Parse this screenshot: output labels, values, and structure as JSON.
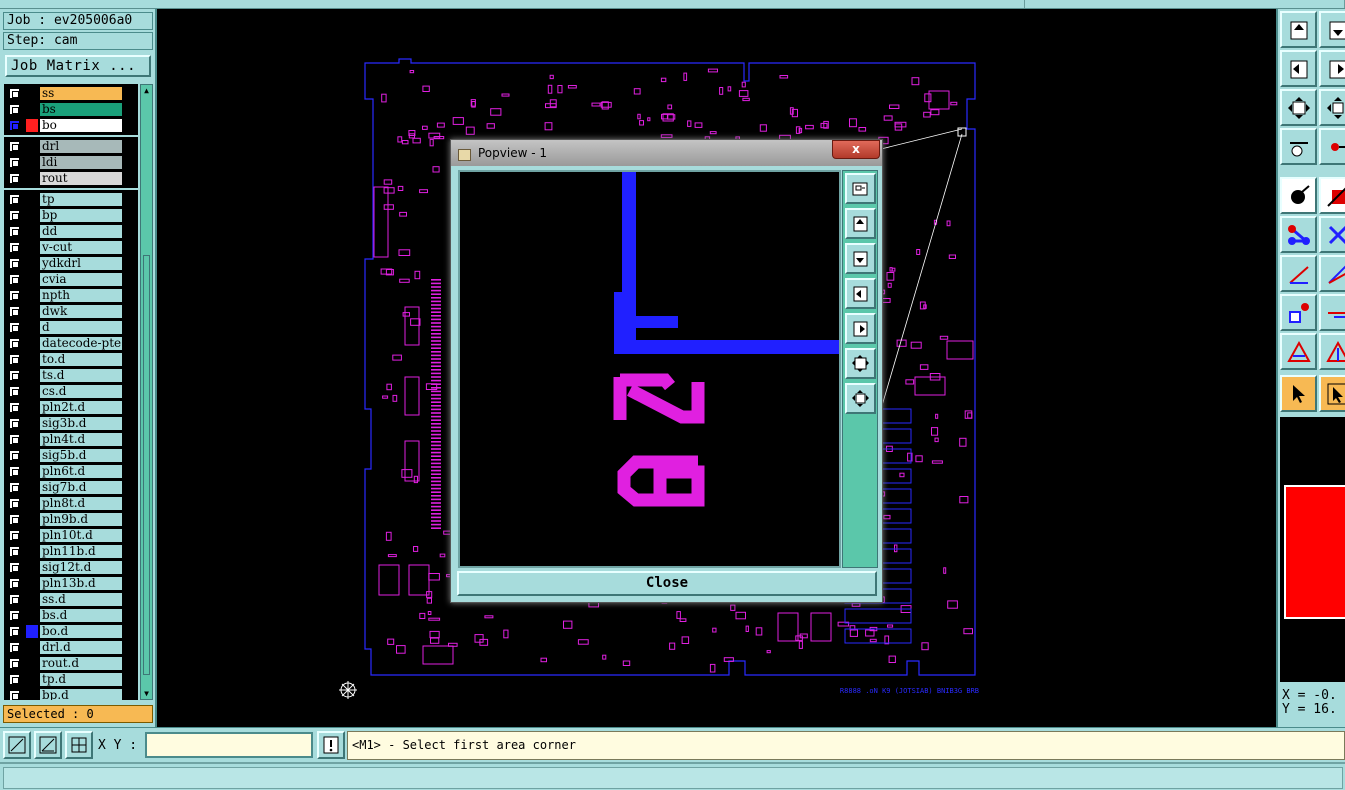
{
  "job": {
    "job_label": "Job : ev205006a0",
    "step_label": "Step: cam",
    "matrix_button": "Job Matrix ..."
  },
  "layers": [
    {
      "name": "ss",
      "color": "#f7b953",
      "swatch": "#000"
    },
    {
      "name": "bs",
      "color": "#1aa07a",
      "swatch": "#000"
    },
    {
      "name": "bo",
      "color": "#ffffff",
      "swatch": "#ff2020",
      "active": true
    },
    {
      "name": "drl",
      "color": "#a7b9b9",
      "swatch": "#000"
    },
    {
      "name": "ldi",
      "color": "#a7b9b9",
      "swatch": "#000"
    },
    {
      "name": "rout",
      "color": "#d8d8d8",
      "swatch": "#000"
    },
    {
      "name": "tp",
      "color": "#a7dcdc",
      "swatch": "#000"
    },
    {
      "name": "bp",
      "color": "#a7dcdc",
      "swatch": "#000"
    },
    {
      "name": "dd",
      "color": "#a7dcdc",
      "swatch": "#000"
    },
    {
      "name": "v-cut",
      "color": "#a7dcdc",
      "swatch": "#000"
    },
    {
      "name": "ydkdrl",
      "color": "#a7dcdc",
      "swatch": "#000"
    },
    {
      "name": "cvia",
      "color": "#a7dcdc",
      "swatch": "#000"
    },
    {
      "name": "npth",
      "color": "#a7dcdc",
      "swatch": "#000"
    },
    {
      "name": "dwk",
      "color": "#a7dcdc",
      "swatch": "#000"
    },
    {
      "name": "d",
      "color": "#a7dcdc",
      "swatch": "#000"
    },
    {
      "name": "datecode-pte",
      "color": "#a7dcdc",
      "swatch": "#000"
    },
    {
      "name": "to.d",
      "color": "#a7dcdc",
      "swatch": "#000"
    },
    {
      "name": "ts.d",
      "color": "#a7dcdc",
      "swatch": "#000"
    },
    {
      "name": "cs.d",
      "color": "#a7dcdc",
      "swatch": "#000"
    },
    {
      "name": "pln2t.d",
      "color": "#a7dcdc",
      "swatch": "#000"
    },
    {
      "name": "sig3b.d",
      "color": "#a7dcdc",
      "swatch": "#000"
    },
    {
      "name": "pln4t.d",
      "color": "#a7dcdc",
      "swatch": "#000"
    },
    {
      "name": "sig5b.d",
      "color": "#a7dcdc",
      "swatch": "#000"
    },
    {
      "name": "pln6t.d",
      "color": "#a7dcdc",
      "swatch": "#000"
    },
    {
      "name": "sig7b.d",
      "color": "#a7dcdc",
      "swatch": "#000"
    },
    {
      "name": "pln8t.d",
      "color": "#a7dcdc",
      "swatch": "#000"
    },
    {
      "name": "pln9b.d",
      "color": "#a7dcdc",
      "swatch": "#000"
    },
    {
      "name": "pln10t.d",
      "color": "#a7dcdc",
      "swatch": "#000"
    },
    {
      "name": "pln11b.d",
      "color": "#a7dcdc",
      "swatch": "#000"
    },
    {
      "name": "sig12t.d",
      "color": "#a7dcdc",
      "swatch": "#000"
    },
    {
      "name": "pln13b.d",
      "color": "#a7dcdc",
      "swatch": "#000"
    },
    {
      "name": "ss.d",
      "color": "#a7dcdc",
      "swatch": "#000"
    },
    {
      "name": "bs.d",
      "color": "#a7dcdc",
      "swatch": "#000"
    },
    {
      "name": "bo.d",
      "color": "#a7dcdc",
      "swatch": "#2020ff"
    },
    {
      "name": "drl.d",
      "color": "#a7dcdc",
      "swatch": "#000"
    },
    {
      "name": "rout.d",
      "color": "#a7dcdc",
      "swatch": "#000"
    },
    {
      "name": "tp.d",
      "color": "#a7dcdc",
      "swatch": "#000"
    },
    {
      "name": "bp.d",
      "color": "#a7dcdc",
      "swatch": "#000"
    }
  ],
  "selected_label": "Selected : 0",
  "popview": {
    "title": "Popview - 1",
    "close_label": "Close",
    "close_x": "x"
  },
  "coords": {
    "x_label": "X = -0.",
    "y_label": "Y = 16."
  },
  "bottom": {
    "xy_label": "X Y :",
    "xy_value": "",
    "message": "<M1> - Select first area corner",
    "info_button": "!"
  },
  "colors": {
    "panel": "#a7dcdc",
    "board_outline": "#2a2aff",
    "silk": "#e020e0",
    "selected": "#f7b953"
  }
}
